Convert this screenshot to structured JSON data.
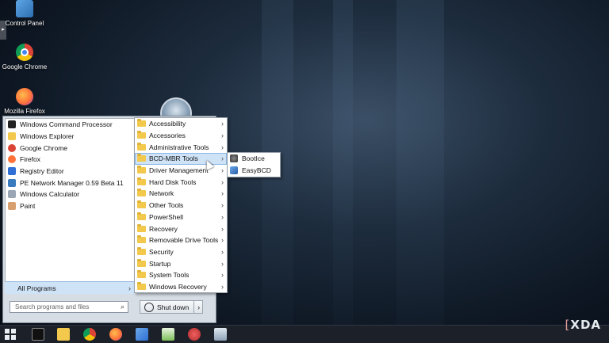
{
  "desktop": {
    "icons": [
      {
        "label": "Control Panel",
        "icon": "control-panel-icon"
      },
      {
        "label": "Google Chrome",
        "icon": "chrome-icon"
      },
      {
        "label": "Mozilla Firefox",
        "icon": "firefox-icon"
      }
    ]
  },
  "start_menu": {
    "programs": [
      {
        "label": "Windows Command Processor",
        "icon": "cmd-icon",
        "color": "#222222"
      },
      {
        "label": "Windows Explorer",
        "icon": "folder-icon",
        "color": "#f2c94c"
      },
      {
        "label": "Google Chrome",
        "icon": "chrome-icon",
        "color": "#db4437"
      },
      {
        "label": "Firefox",
        "icon": "firefox-icon",
        "color": "#ff7139"
      },
      {
        "label": "Registry Editor",
        "icon": "registry-icon",
        "color": "#2f6fd6"
      },
      {
        "label": "PE Network Manager 0.59 Beta 11",
        "icon": "network-icon",
        "color": "#3a7bbf"
      },
      {
        "label": "Windows Calculator",
        "icon": "calculator-icon",
        "color": "#9aa6b4"
      },
      {
        "label": "Paint",
        "icon": "paint-icon",
        "color": "#d8a070"
      }
    ],
    "all_programs": "All Programs",
    "search_placeholder": "Search programs and files",
    "shutdown_label": "Shut down"
  },
  "programs_submenu": [
    {
      "label": "Accessibility"
    },
    {
      "label": "Accessories"
    },
    {
      "label": "Administrative Tools"
    },
    {
      "label": "BCD-MBR Tools",
      "highlighted": true
    },
    {
      "label": "Driver Management"
    },
    {
      "label": "Hard Disk Tools"
    },
    {
      "label": "Network"
    },
    {
      "label": "Other Tools"
    },
    {
      "label": "PowerShell"
    },
    {
      "label": "Recovery"
    },
    {
      "label": "Removable Drive Tools"
    },
    {
      "label": "Security"
    },
    {
      "label": "Startup"
    },
    {
      "label": "System Tools"
    },
    {
      "label": "Windows Recovery"
    }
  ],
  "bcd_submenu": [
    {
      "label": "BootIce",
      "icon": "bootice-icon"
    },
    {
      "label": "EasyBCD",
      "icon": "easybcd-icon"
    }
  ],
  "taskbar": {
    "items": [
      "start-icon",
      "cmd-icon",
      "explorer-icon",
      "chrome-icon",
      "firefox-icon",
      "registry-icon",
      "notepad-icon",
      "paint-icon",
      "calculator-icon"
    ]
  },
  "watermark": "XDA"
}
